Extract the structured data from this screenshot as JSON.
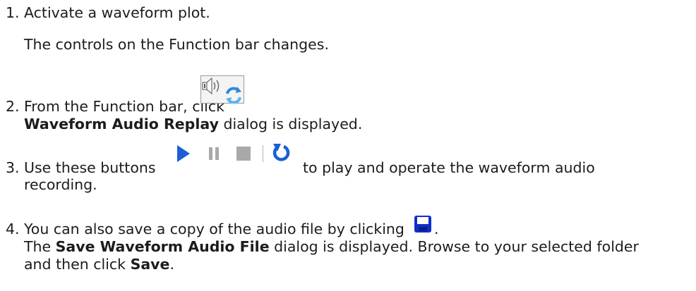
{
  "steps": [
    {
      "number": "1.",
      "text": "Activate a waveform plot.",
      "result": "The controls on the Function bar changes."
    },
    {
      "number": "2.",
      "text": "From the Function bar, click",
      "result_bold": "Waveform Audio Replay",
      "result_after": "dialog is displayed."
    },
    {
      "number": "3.",
      "before": "Use these buttons",
      "after": "to play and operate the waveform audio",
      "continuation": "recording."
    },
    {
      "number": "4.",
      "text": "You can also save a copy of the audio file by clicking",
      "text_end": ".",
      "result_pre": "The",
      "result_bold": "Save Waveform Audio File",
      "result_mid": "dialog is displayed. Browse to your selected folder",
      "result_line2_pre": "and then click",
      "result_line2_bold": "Save",
      "result_line2_end": "."
    }
  ],
  "icons": {
    "audio_replay": "speaker-refresh-icon",
    "play": "play-icon",
    "pause": "pause-icon",
    "stop": "stop-icon",
    "replay": "replay-icon",
    "save": "floppy-save-icon"
  },
  "colors": {
    "text": "#1c1c1c",
    "play_blue": "#1a5fd6",
    "control_gray": "#a9a9a9",
    "save_blue": "#1030c8"
  }
}
